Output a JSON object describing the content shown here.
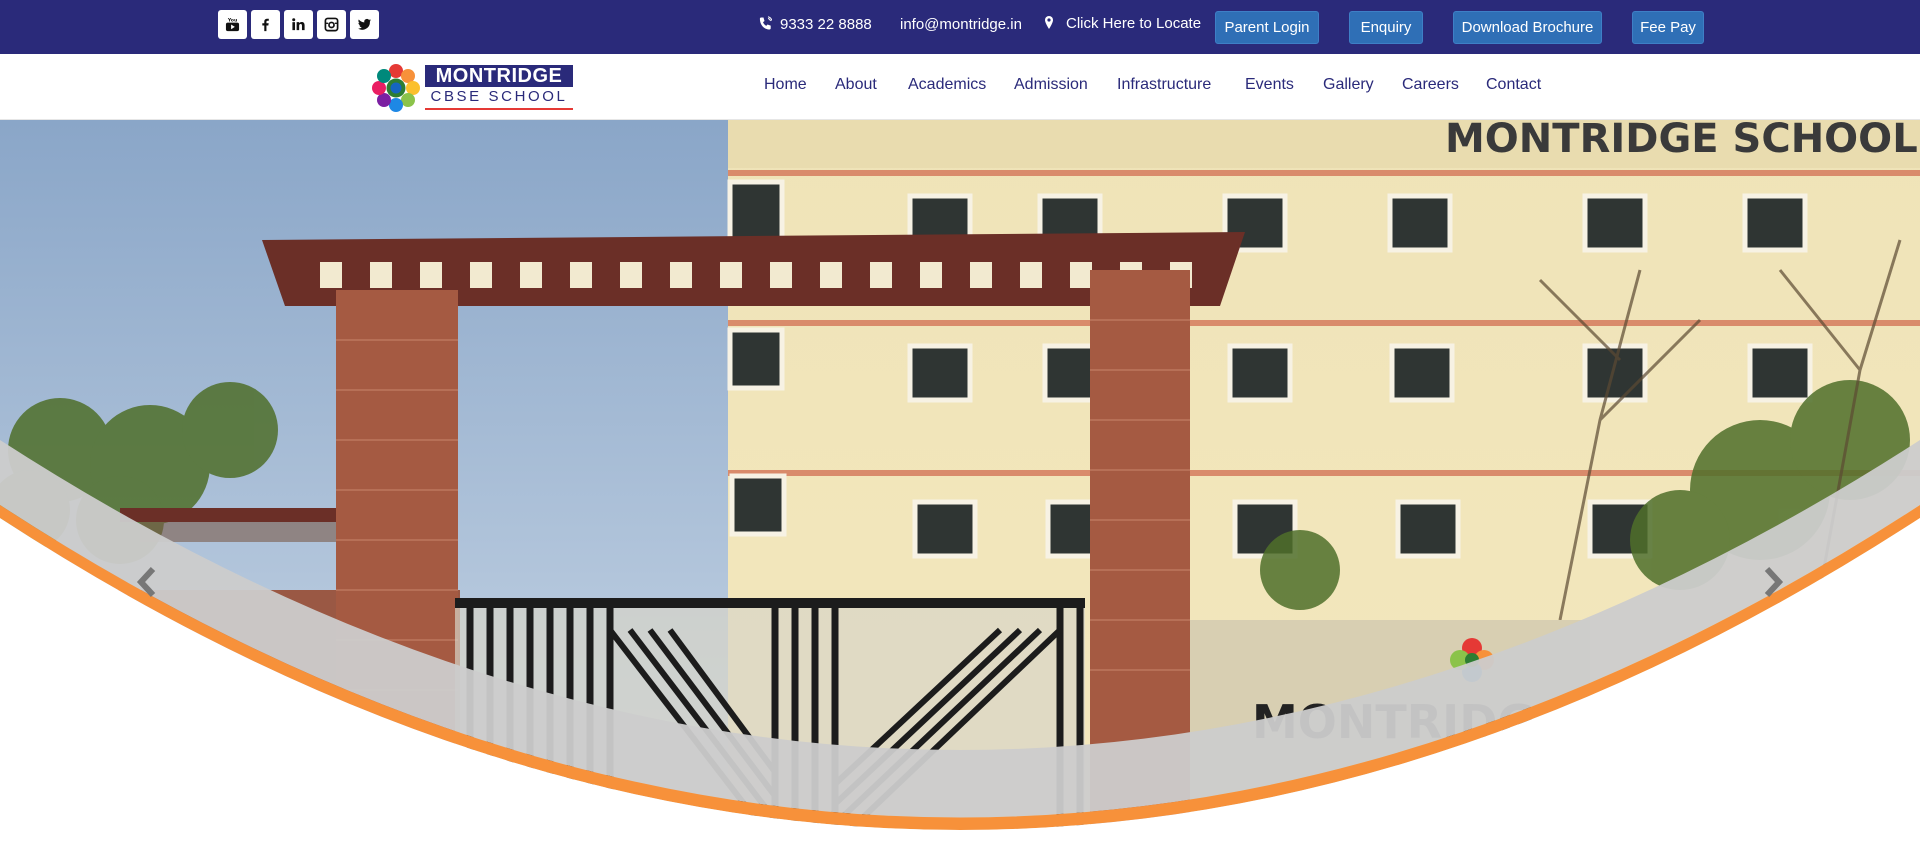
{
  "topbar": {
    "social": [
      {
        "name": "youtube-icon",
        "glyph": "▶"
      },
      {
        "name": "facebook-icon",
        "glyph": "f"
      },
      {
        "name": "linkedin-icon",
        "glyph": "in"
      },
      {
        "name": "instagram-icon",
        "glyph": "◙"
      },
      {
        "name": "twitter-icon",
        "glyph": "t"
      }
    ],
    "phone": "9333 22 8888",
    "email": "info@montridge.in",
    "locate": "Click Here to Locate",
    "buttons": {
      "parent_login": "Parent Login",
      "enquiry": "Enquiry",
      "download_brochure": "Download Brochure",
      "fee_pay": "Fee Pay"
    }
  },
  "logo": {
    "title": "MONTRIDGE",
    "subtitle": "CBSE SCHOOL"
  },
  "nav": {
    "items": [
      "Home",
      "About",
      "Academics",
      "Admission",
      "Infrastructure",
      "Events",
      "Gallery",
      "Careers",
      "Contact"
    ]
  },
  "hero": {
    "building_sign": "MONTRIDGE SCHOOL",
    "wall_sign": "MONTRIDG"
  },
  "colors": {
    "topbar_bg": "#2a2a7a",
    "button_bg": "#2f6fb6",
    "nav_text": "#2a2a7a",
    "accent_orange": "#f7913a",
    "swoosh_grey": "#cccccc"
  }
}
